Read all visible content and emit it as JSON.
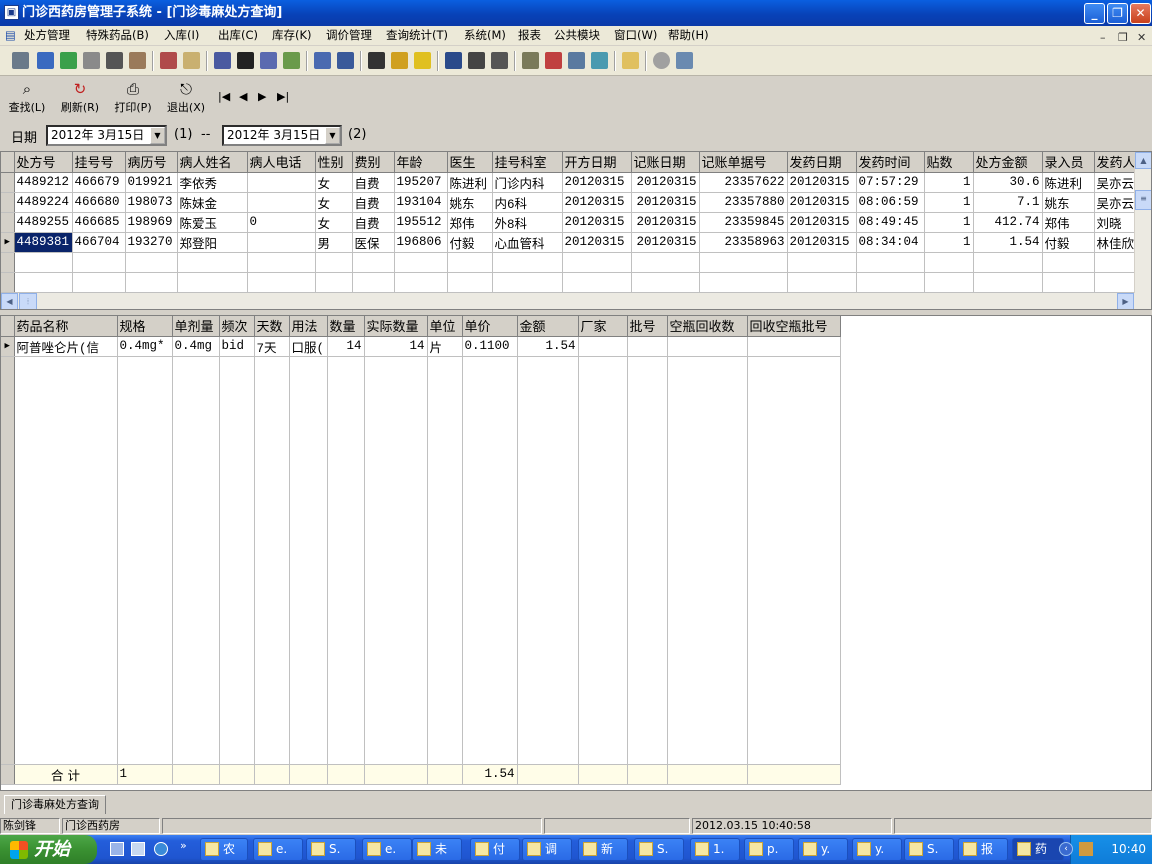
{
  "window": {
    "title": "门诊西药房管理子系统 - [门诊毒麻处方查询]"
  },
  "menu": [
    "处方管理",
    "特殊药品(B)",
    "入库(I)",
    "出库(C)",
    "库存(K)",
    "调价管理",
    "查询统计(T)",
    "系统(M)",
    "报表",
    "公共模块",
    "窗口(W)",
    "帮助(H)"
  ],
  "toolbar2": {
    "find": "查找(L)",
    "refresh": "刷新(R)",
    "print": "打印(P)",
    "exit": "退出(X)",
    "first": "|◀",
    "prev": "◀",
    "next": "▶",
    "last": "▶|"
  },
  "datebar": {
    "label": "日期",
    "from": "2012年 3月15日",
    "sep1": "(1)",
    "dash": "--",
    "to": "2012年 3月15日",
    "sep2": "(2)"
  },
  "prescriptions": {
    "headers": [
      "处方号",
      "挂号号",
      "病历号",
      "病人姓名",
      "病人电话",
      "性别",
      "费别",
      "年龄",
      "医生",
      "挂号科室",
      "开方日期",
      "记账日期",
      "记账单据号",
      "发药日期",
      "发药时间",
      "贴数",
      "处方金额",
      "录入员",
      "发药人"
    ],
    "rows": [
      [
        "4489212",
        "466679",
        "019921",
        "李依秀",
        "",
        "女",
        "自费",
        "195207",
        "陈进利",
        "门诊内科",
        "20120315",
        "20120315",
        "23357622",
        "20120315",
        "07:57:29",
        "1",
        "30.6",
        "陈进利",
        "吴亦云"
      ],
      [
        "4489224",
        "466680",
        "198073",
        "陈妹金",
        "",
        "女",
        "自费",
        "193104",
        "姚东",
        "内6科",
        "20120315",
        "20120315",
        "23357880",
        "20120315",
        "08:06:59",
        "1",
        "7.1",
        "姚东",
        "吴亦云"
      ],
      [
        "4489255",
        "466685",
        "198969",
        "陈爱玉",
        "0",
        "女",
        "自费",
        "195512",
        "郑伟",
        "外8科",
        "20120315",
        "20120315",
        "23359845",
        "20120315",
        "08:49:45",
        "1",
        "412.74",
        "郑伟",
        "刘晓"
      ],
      [
        "4489381",
        "466704",
        "193270",
        "郑登阳",
        "",
        "男",
        "医保",
        "196806",
        "付毅",
        "心血管科",
        "20120315",
        "20120315",
        "23358963",
        "20120315",
        "08:34:04",
        "1",
        "1.54",
        "付毅",
        "林佳欣"
      ]
    ]
  },
  "drugs": {
    "headers": [
      "药品名称",
      "规格",
      "单剂量",
      "频次",
      "天数",
      "用法",
      "数量",
      "实际数量",
      "单位",
      "单价",
      "金额",
      "厂家",
      "批号",
      "空瓶回收数",
      "回收空瓶批号"
    ],
    "rows": [
      [
        "阿普唑仑片(信",
        "0.4mg*",
        "0.4mg",
        "bid",
        "7天",
        "口服(",
        "14",
        "14",
        "片",
        "0.1100",
        "1.54",
        "",
        "",
        "",
        ""
      ]
    ],
    "summary": {
      "label": "合  计",
      "count": "1",
      "amount": "1.54"
    }
  },
  "tab": {
    "label": "门诊毒麻处方查询"
  },
  "status": {
    "user": "陈剑锋",
    "dept": "门诊西药房",
    "datetime": "2012.03.15 10:40:58"
  },
  "taskbar": {
    "start": "开始",
    "items": [
      "农",
      "e.",
      "S.",
      "e.",
      "未",
      "付",
      "调",
      "新",
      "S.",
      "1.",
      "p.",
      "y.",
      "y.",
      "S.",
      "报",
      "药"
    ],
    "clock": "10:40"
  }
}
